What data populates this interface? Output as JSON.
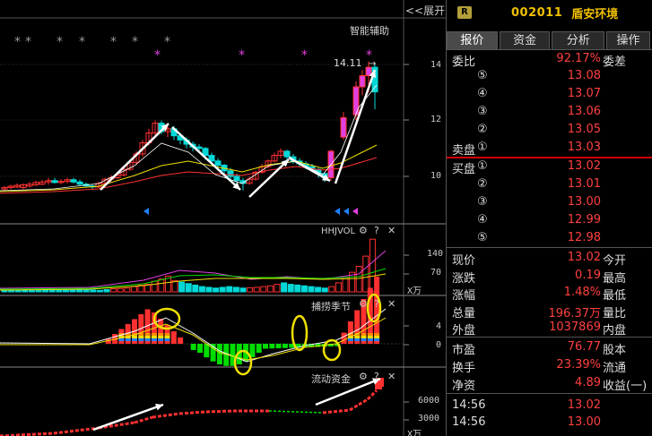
{
  "chart": {
    "expand_label": "<<展开",
    "indicator_main": "智能辅助",
    "price_high_label": "14.11",
    "price_axis": [
      "14",
      "12",
      "10"
    ],
    "vol_pane_title": "HHJVOL",
    "vol_axis": [
      "140",
      "70"
    ],
    "vol_unit": "X万",
    "season_pane_title": "捕捞季节",
    "season_axis": [
      "4",
      "0"
    ],
    "flow_pane_title": "流动资金",
    "flow_axis": [
      "6000",
      "3000"
    ],
    "flow_unit": "X万",
    "gear_icon": "⚙",
    "help_icon": "?",
    "close_icon": "✕",
    "colors": {
      "up": "#ff3030",
      "down": "#00d8d8",
      "ma_white": "#ffffff",
      "ma_yellow": "#f0e000",
      "ma_red": "#ff3030",
      "pink": "#e040e0",
      "green": "#00dd00"
    }
  },
  "stock": {
    "badge": "R",
    "code": "002011",
    "name": "盾安环境"
  },
  "tabs": [
    "报价",
    "资金",
    "分析",
    "操作"
  ],
  "weibi": {
    "label": "委比",
    "value": "92.17%",
    "label2": "委差"
  },
  "sell_levels": [
    {
      "label": "",
      "num": "⑤",
      "price": "13.08"
    },
    {
      "label": "",
      "num": "④",
      "price": "13.07"
    },
    {
      "label": "",
      "num": "③",
      "price": "13.06"
    },
    {
      "label": "",
      "num": "②",
      "price": "13.05"
    },
    {
      "label": "卖盘",
      "num": "①",
      "price": "13.03"
    }
  ],
  "buy_levels": [
    {
      "label": "买盘",
      "num": "①",
      "price": "13.02"
    },
    {
      "label": "",
      "num": "②",
      "price": "13.01"
    },
    {
      "label": "",
      "num": "③",
      "price": "13.00"
    },
    {
      "label": "",
      "num": "④",
      "price": "12.99"
    },
    {
      "label": "",
      "num": "⑤",
      "price": "12.98"
    }
  ],
  "stats1": [
    {
      "label": "现价",
      "value": "13.02",
      "label2": "今开",
      "color": "red"
    },
    {
      "label": "涨跌",
      "value": "0.19",
      "label2": "最高",
      "color": "red"
    },
    {
      "label": "涨幅",
      "value": "1.48%",
      "label2": "最低",
      "color": "red"
    },
    {
      "label": "总量",
      "value": "196.37万",
      "label2": "量比",
      "color": "yellow"
    },
    {
      "label": "外盘",
      "value": "1037869",
      "label2": "内盘",
      "color": "red"
    }
  ],
  "stats2": [
    {
      "label": "市盈",
      "value": "76.77",
      "label2": "股本",
      "color": "white"
    },
    {
      "label": "换手",
      "value": "23.39%",
      "label2": "流通",
      "color": "white"
    },
    {
      "label": "净资",
      "value": "4.89",
      "label2": "收益(一)",
      "color": "white"
    }
  ],
  "ticks": [
    {
      "time": "14:56",
      "price": "13.02"
    },
    {
      "time": "14:56",
      "price": "13.00"
    }
  ]
}
